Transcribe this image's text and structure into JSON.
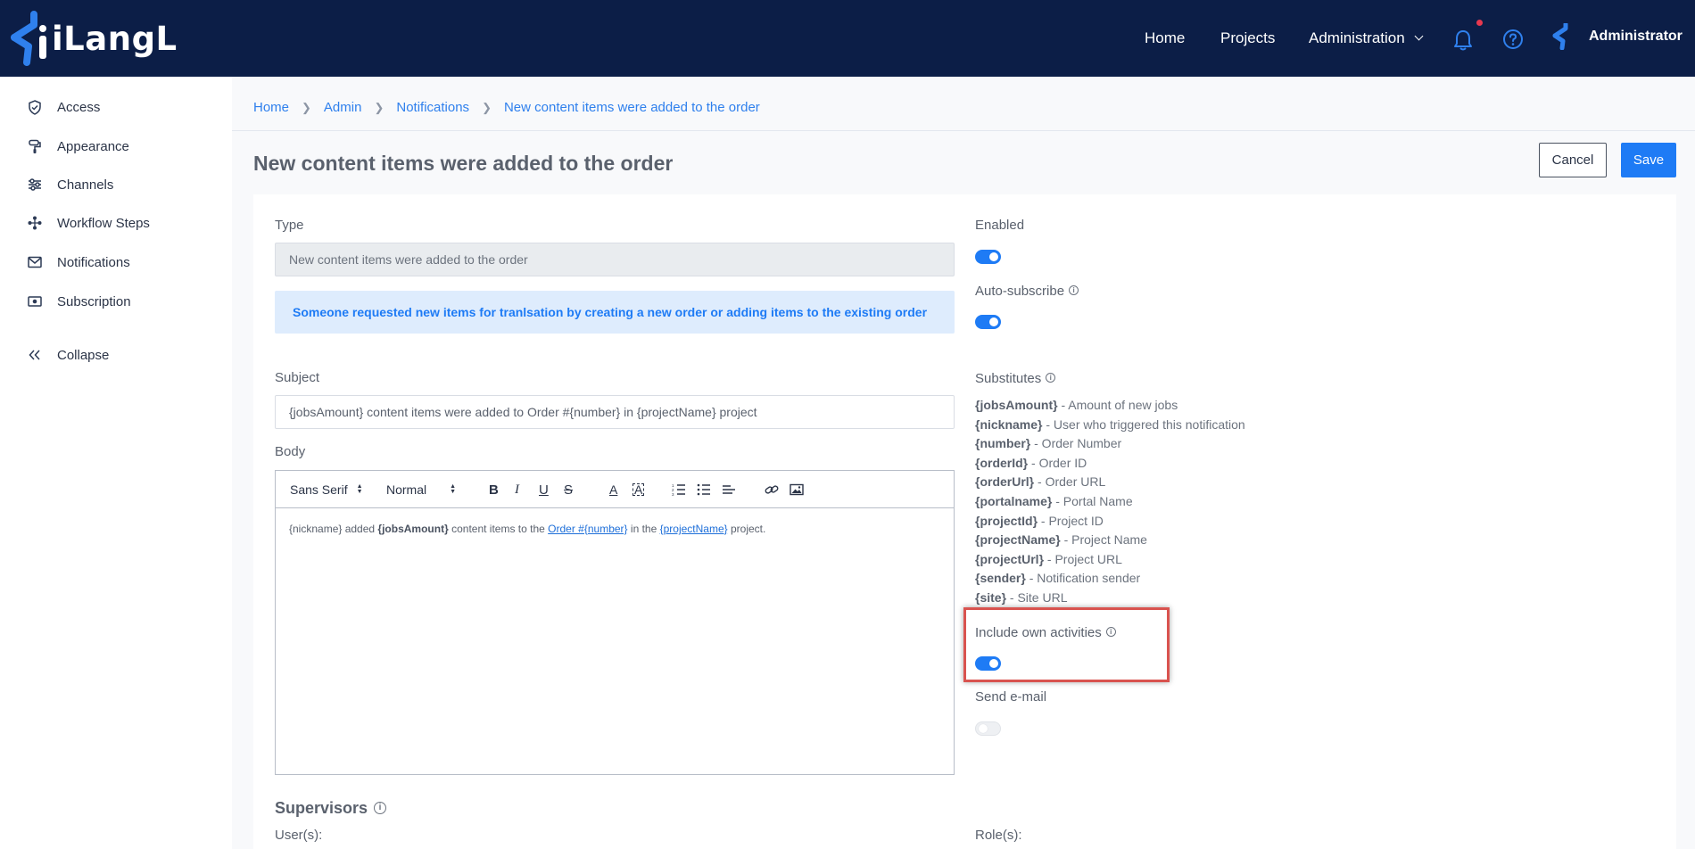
{
  "brand": {
    "name": "iLangL",
    "accent": "#1e7bf5",
    "nav_bg": "#0c1e47"
  },
  "topnav": {
    "home": "Home",
    "projects": "Projects",
    "administration": "Administration",
    "user": "Administrator"
  },
  "sidebar": {
    "items": [
      {
        "label": "Access",
        "icon": "shield-check-icon"
      },
      {
        "label": "Appearance",
        "icon": "paint-roller-icon"
      },
      {
        "label": "Channels",
        "icon": "sliders-icon"
      },
      {
        "label": "Workflow Steps",
        "icon": "workflow-icon"
      },
      {
        "label": "Notifications",
        "icon": "envelope-icon"
      },
      {
        "label": "Subscription",
        "icon": "ticket-icon"
      }
    ],
    "collapse": "Collapse"
  },
  "breadcrumb": [
    "Home",
    "Admin",
    "Notifications",
    "New content items were added to the order"
  ],
  "page": {
    "title": "New content items were added to the order",
    "cancel": "Cancel",
    "save": "Save"
  },
  "form": {
    "type_label": "Type",
    "type_value": "New content items were added to the order",
    "info": "Someone requested new items for tranlsation by creating a new order or adding items to the existing order",
    "subject_label": "Subject",
    "subject_value": "{jobsAmount} content items were added to Order #{number} in {projectName} project",
    "body_label": "Body",
    "editor": {
      "font": "Sans Serif",
      "size": "Normal",
      "body": {
        "t1": "{nickname} added ",
        "b1": "{jobsAmount}",
        "t2": " content items to the ",
        "link1": "Order #{number}",
        "t3": " in the ",
        "link2": "{projectName}",
        "t4": " project."
      }
    },
    "enabled_label": "Enabled",
    "enabled": true,
    "autosub_label": "Auto-subscribe",
    "autosub": true,
    "substitutes_label": "Substitutes",
    "substitutes": [
      {
        "key": "{jobsAmount}",
        "desc": " - Amount of new jobs"
      },
      {
        "key": "{nickname}",
        "desc": " - User who triggered this notification"
      },
      {
        "key": "{number}",
        "desc": " - Order Number"
      },
      {
        "key": "{orderId}",
        "desc": " - Order ID"
      },
      {
        "key": "{orderUrl}",
        "desc": " - Order URL"
      },
      {
        "key": "{portalname}",
        "desc": " - Portal Name"
      },
      {
        "key": "{projectId}",
        "desc": " - Project ID"
      },
      {
        "key": "{projectName}",
        "desc": " - Project Name"
      },
      {
        "key": "{projectUrl}",
        "desc": " - Project URL"
      },
      {
        "key": "{sender}",
        "desc": " - Notification sender"
      },
      {
        "key": "{site}",
        "desc": " - Site URL"
      }
    ],
    "own_label": "Include own activities",
    "own": true,
    "email_label": "Send e-mail",
    "email": false,
    "supervisors_title": "Supervisors",
    "users_label": "User(s):",
    "roles_label": "Role(s):"
  }
}
